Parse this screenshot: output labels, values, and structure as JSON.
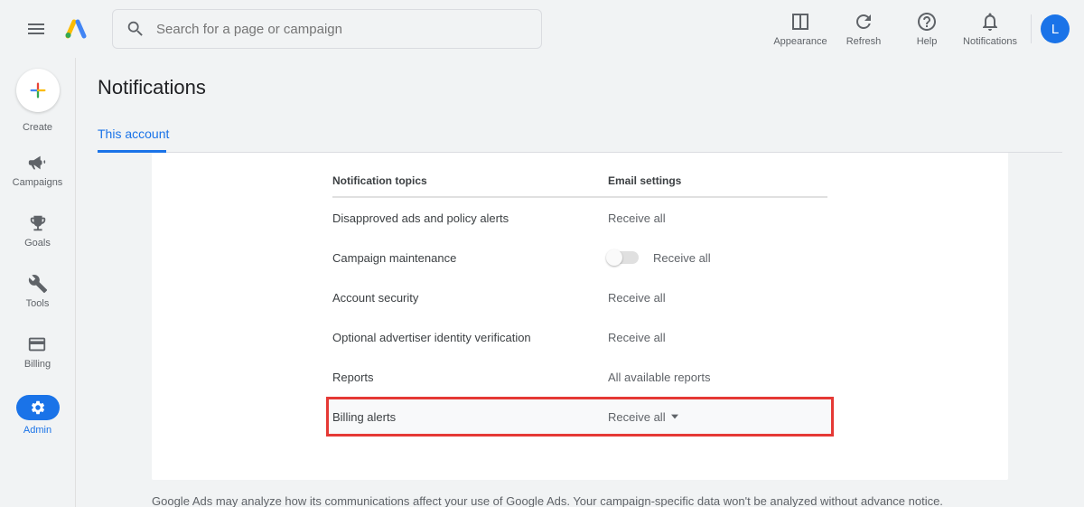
{
  "header": {
    "search_placeholder": "Search for a page or campaign",
    "actions": {
      "appearance": "Appearance",
      "refresh": "Refresh",
      "help": "Help",
      "notifications": "Notifications"
    },
    "avatar_letter": "L"
  },
  "sidebar": {
    "create": "Create",
    "campaigns": "Campaigns",
    "goals": "Goals",
    "tools": "Tools",
    "billing": "Billing",
    "admin": "Admin"
  },
  "page": {
    "title": "Notifications",
    "tab": "This account"
  },
  "table": {
    "header_topics": "Notification topics",
    "header_settings": "Email settings",
    "rows": [
      {
        "topic": "Disapproved ads and policy alerts",
        "setting": "Receive all"
      },
      {
        "topic": "Campaign maintenance",
        "setting": "Receive all"
      },
      {
        "topic": "Account security",
        "setting": "Receive all"
      },
      {
        "topic": "Optional advertiser identity verification",
        "setting": "Receive all"
      },
      {
        "topic": "Reports",
        "setting": "All available reports"
      },
      {
        "topic": "Billing alerts",
        "setting": "Receive all"
      }
    ]
  },
  "disclaimer": "Google Ads may analyze how its communications affect your use of Google Ads. Your campaign-specific data won't be analyzed without advance notice."
}
